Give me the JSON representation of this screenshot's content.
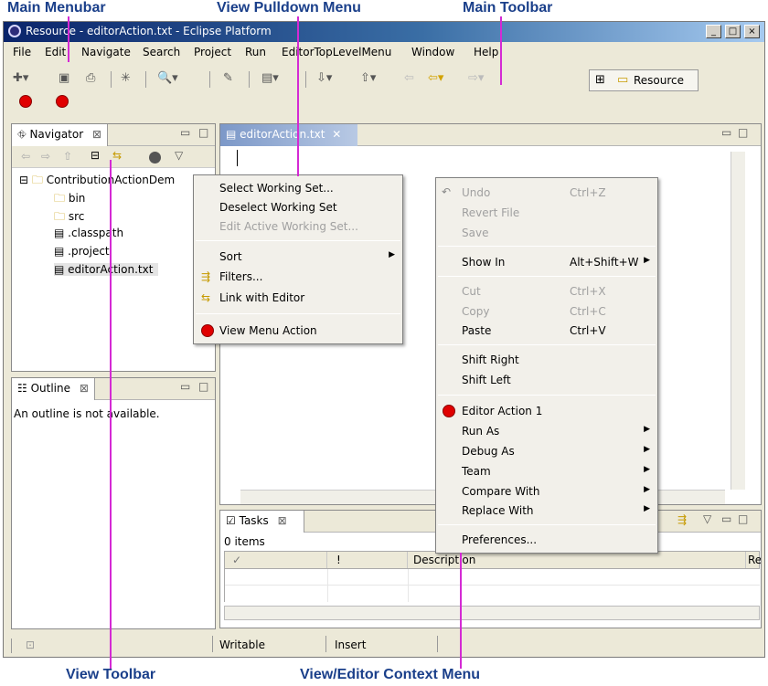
{
  "callouts": {
    "main_menubar": "Main Menubar",
    "view_pulldown": "View Pulldown Menu",
    "main_toolbar": "Main Toolbar",
    "view_toolbar": "View Toolbar",
    "context_menu": "View/Editor Context Menu"
  },
  "window": {
    "title": "Resource - editorAction.txt - Eclipse Platform",
    "controls": [
      "_",
      "□",
      "×"
    ]
  },
  "menubar": [
    "File",
    "Edit",
    "Navigate",
    "Search",
    "Project",
    "Run",
    "EditorTopLevelMenu",
    "Window",
    "Help"
  ],
  "toolbar": {
    "perspective": "Resource"
  },
  "navigator": {
    "title": "Navigator",
    "tree": {
      "project": "ContributionActionDem",
      "items": [
        "bin",
        "src",
        ".classpath",
        ".project",
        "editorAction.txt"
      ]
    }
  },
  "pulldown": {
    "items": [
      {
        "label": "Select Working Set...",
        "enabled": true
      },
      {
        "label": "Deselect Working Set",
        "enabled": true
      },
      {
        "label": "Edit Active Working Set...",
        "enabled": false
      },
      {
        "label": "Sort",
        "enabled": true,
        "submenu": true
      },
      {
        "label": "Filters...",
        "enabled": true
      },
      {
        "label": "Link with Editor",
        "enabled": true
      },
      {
        "label": "View Menu Action",
        "enabled": true
      }
    ]
  },
  "outline": {
    "title": "Outline",
    "message": "An outline is not available."
  },
  "editor": {
    "tab": "editorAction.txt"
  },
  "context_menu": {
    "items": [
      {
        "label": "Undo",
        "shortcut": "Ctrl+Z",
        "enabled": false
      },
      {
        "label": "Revert File",
        "shortcut": "",
        "enabled": false
      },
      {
        "label": "Save",
        "shortcut": "",
        "enabled": false
      },
      {
        "label": "Show In",
        "shortcut": "Alt+Shift+W",
        "enabled": true,
        "submenu": true
      },
      {
        "label": "Cut",
        "shortcut": "Ctrl+X",
        "enabled": false
      },
      {
        "label": "Copy",
        "shortcut": "Ctrl+C",
        "enabled": false
      },
      {
        "label": "Paste",
        "shortcut": "Ctrl+V",
        "enabled": true
      },
      {
        "label": "Shift Right",
        "shortcut": "",
        "enabled": true
      },
      {
        "label": "Shift Left",
        "shortcut": "",
        "enabled": true
      },
      {
        "label": "Editor Action 1",
        "shortcut": "",
        "enabled": true
      },
      {
        "label": "Run As",
        "shortcut": "",
        "enabled": true,
        "submenu": true
      },
      {
        "label": "Debug As",
        "shortcut": "",
        "enabled": true,
        "submenu": true
      },
      {
        "label": "Team",
        "shortcut": "",
        "enabled": true,
        "submenu": true
      },
      {
        "label": "Compare With",
        "shortcut": "",
        "enabled": true,
        "submenu": true
      },
      {
        "label": "Replace With",
        "shortcut": "",
        "enabled": true,
        "submenu": true
      },
      {
        "label": "Preferences...",
        "shortcut": "",
        "enabled": true
      }
    ]
  },
  "tasks": {
    "title": "Tasks",
    "count": "0 items",
    "columns": [
      "✓",
      "!",
      "Description",
      "Re"
    ]
  },
  "statusbar": {
    "writable": "Writable",
    "insert": "Insert"
  },
  "colors": {
    "callout_text": "#1a3f8a",
    "leader_line": "#d42ad4",
    "action_dot": "#e00000"
  }
}
